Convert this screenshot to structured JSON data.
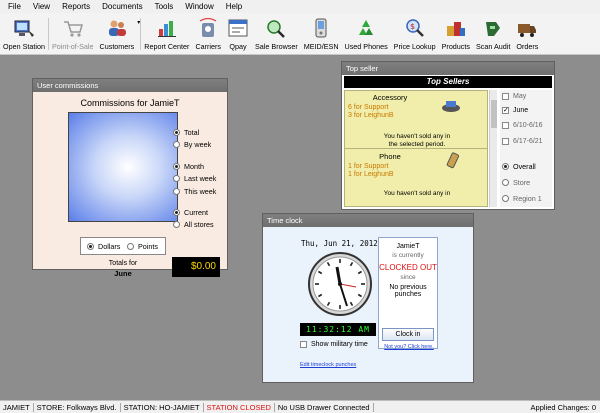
{
  "menu": [
    "File",
    "View",
    "Reports",
    "Documents",
    "Tools",
    "Window",
    "Help"
  ],
  "toolbar": [
    {
      "label": "Open Station",
      "icon": "open-station-icon",
      "disabled": false
    },
    {
      "label": "Point-of-Sale",
      "icon": "cart-icon",
      "disabled": true
    },
    {
      "label": "Customers",
      "icon": "customers-icon",
      "disabled": false
    },
    {
      "label": "Report Center",
      "icon": "report-center-icon",
      "disabled": false
    },
    {
      "label": "Carriers",
      "icon": "carriers-icon",
      "disabled": false
    },
    {
      "label": "Qpay",
      "icon": "qpay-icon",
      "disabled": false
    },
    {
      "label": "Sale Browser",
      "icon": "sale-browser-icon",
      "disabled": false
    },
    {
      "label": "MEID/ESN",
      "icon": "phone-icon",
      "disabled": false
    },
    {
      "label": "Used Phones",
      "icon": "recycle-icon",
      "disabled": false
    },
    {
      "label": "Price Lookup",
      "icon": "price-lookup-icon",
      "disabled": false
    },
    {
      "label": "Products",
      "icon": "products-icon",
      "disabled": false
    },
    {
      "label": "Scan Audit",
      "icon": "scan-audit-icon",
      "disabled": false
    },
    {
      "label": "Orders",
      "icon": "orders-icon",
      "disabled": false
    }
  ],
  "commissions": {
    "window_title": "User commissions",
    "heading": "Commissions for JamieT",
    "scope": [
      {
        "label": "Total",
        "on": true
      },
      {
        "label": "By week",
        "on": false
      }
    ],
    "period": [
      {
        "label": "Month",
        "on": true
      },
      {
        "label": "Last week",
        "on": false
      },
      {
        "label": "This week",
        "on": false
      }
    ],
    "stores": [
      {
        "label": "Current",
        "on": true
      },
      {
        "label": "All stores",
        "on": false
      }
    ],
    "units": [
      {
        "label": "Dollars",
        "on": true
      },
      {
        "label": "Points",
        "on": false
      }
    ],
    "totals_label": "Totals for",
    "totals_month": "June",
    "totals_value": "$0.00"
  },
  "top_seller": {
    "window_title": "Top seller",
    "header": "Top Sellers",
    "cards": [
      {
        "category": "Accessory",
        "line1": "6 for Support",
        "line2": "3 for LeighunB",
        "msg1": "You haven't sold any in",
        "msg2": "the selected period.",
        "icon": "accessory-icon"
      },
      {
        "category": "Phone",
        "line1": "1 for Support",
        "line2": "1 for LeighunB",
        "msg1": "You haven't sold any in",
        "msg2": "",
        "icon": "phone-icon"
      }
    ],
    "periods": [
      {
        "label": "May",
        "checked": false
      },
      {
        "label": "June",
        "checked": true
      },
      {
        "label": "6/10-6/16",
        "checked": false
      },
      {
        "label": "6/17-6/21",
        "checked": false
      }
    ],
    "scopes": [
      {
        "label": "Overall",
        "on": true
      },
      {
        "label": "Store",
        "on": false
      },
      {
        "label": "Region 1",
        "on": false
      }
    ]
  },
  "time_clock": {
    "window_title": "Time clock",
    "date": "Thu, Jun 21, 2012",
    "digital_time": "11:32:12 AM",
    "show_military_label": "Show military time",
    "user": "JamieT",
    "is_currently": "is currently",
    "status": "CLOCKED OUT",
    "since": "since",
    "previous": "No previous",
    "punches": "punches",
    "clock_in_button": "Clock in",
    "not_you": "Not you? Click here.",
    "edit_link": "Edit timeclock punches"
  },
  "statusbar": {
    "user": "JAMIET",
    "store": "STORE: Folkways Blvd.",
    "station": "STATION: HO-JAMIET",
    "station_state": "STATION CLOSED",
    "usb": "No USB Drawer Connected",
    "changes": "Applied Changes: 0"
  },
  "colors": {
    "workspace": "#8d8d8d",
    "station_closed": "#dd1111",
    "digital_green": "#2cff2c",
    "totals_gold": "#ffd800",
    "seller_orange": "#c97800"
  }
}
